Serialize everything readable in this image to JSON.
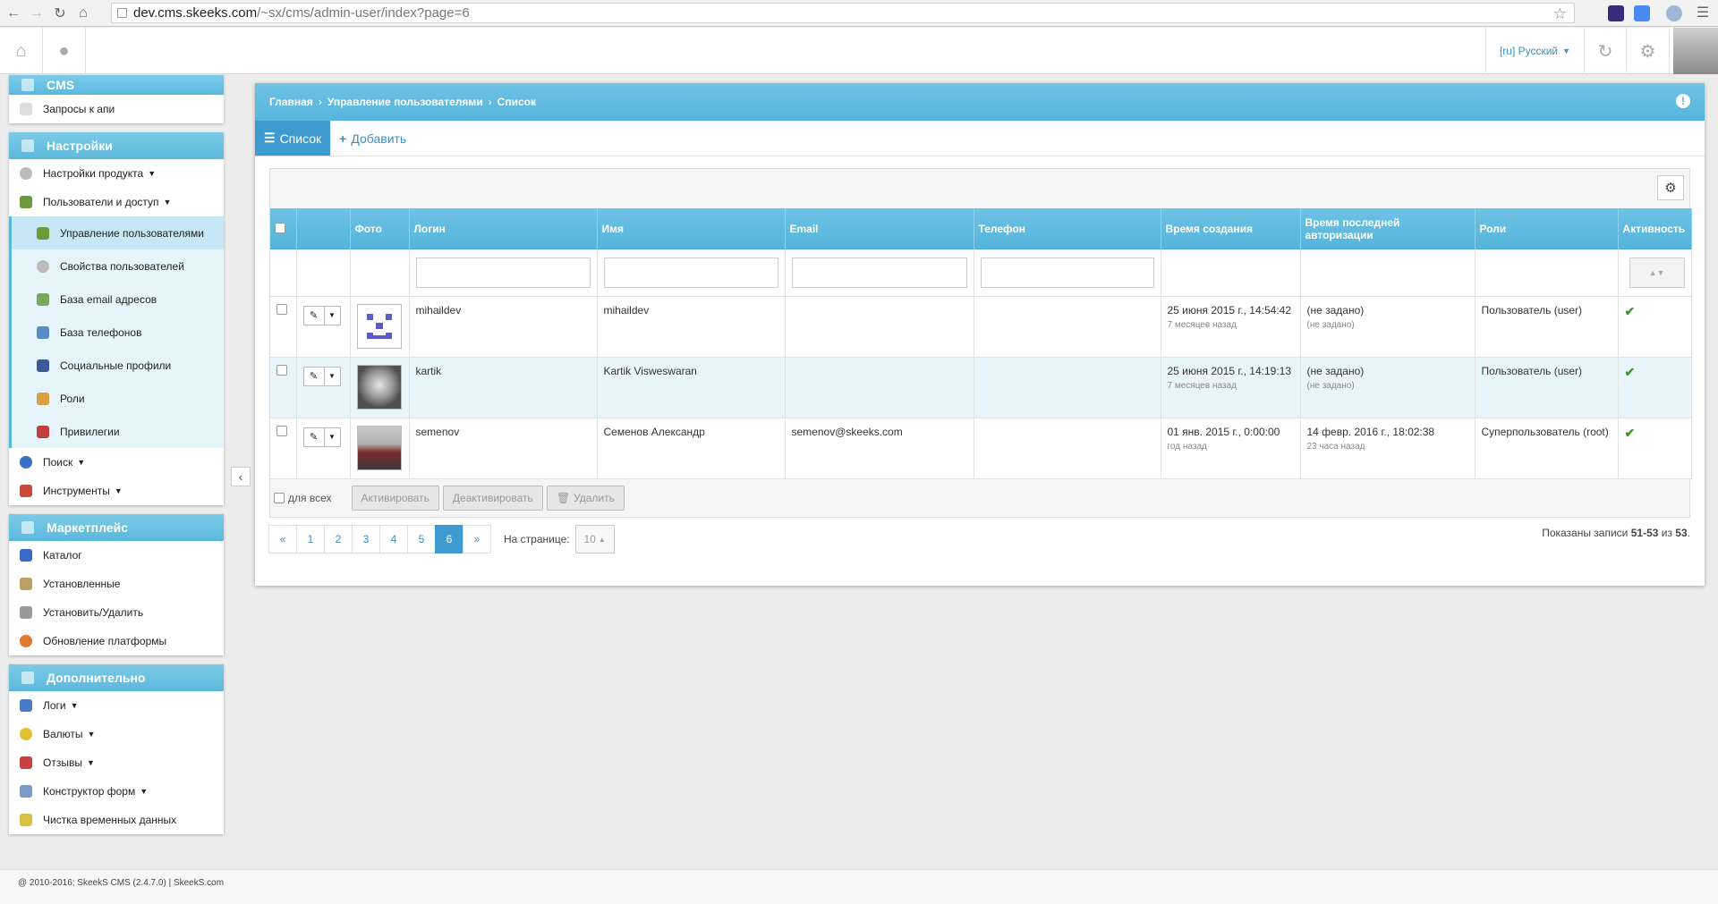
{
  "browser": {
    "url_host": "dev.cms.skeeks.com",
    "url_path": "/~sx/cms/admin-user/index?page=6"
  },
  "topbar": {
    "language": "[ru] Русский"
  },
  "sidebar": {
    "cms": {
      "title": "CMS",
      "items": [
        "Запросы к апи"
      ]
    },
    "settings": {
      "title": "Настройки",
      "items": [
        "Настройки продукта",
        "Пользователи и доступ"
      ],
      "subitems": [
        "Управление пользователями",
        "Свойства пользователей",
        "База email адресов",
        "База телефонов",
        "Социальные профили",
        "Роли",
        "Привилегии"
      ],
      "more": [
        "Поиск",
        "Инструменты"
      ]
    },
    "marketplace": {
      "title": "Маркетплейс",
      "items": [
        "Каталог",
        "Установленные",
        "Установить/Удалить",
        "Обновление платформы"
      ]
    },
    "extra": {
      "title": "Дополнительно",
      "items": [
        "Логи",
        "Валюты",
        "Отзывы",
        "Конструктор форм",
        "Чистка временных данных"
      ]
    }
  },
  "breadcrumb": [
    "Главная",
    "Управление пользователями",
    "Список"
  ],
  "tabs": {
    "list": "Список",
    "add": "Добавить"
  },
  "table": {
    "columns": [
      "Фото",
      "Логин",
      "Имя",
      "Email",
      "Телефон",
      "Время создания",
      "Время последней авторизации",
      "Роли",
      "Активность"
    ],
    "rows": [
      {
        "login": "mihaildev",
        "name": "mihaildev",
        "email": "",
        "phone": "",
        "created": "25 июня 2015 г., 14:54:42",
        "created_ago": "7 месяцев назад",
        "last_auth": "(не задано)",
        "last_auth_sub": "(не задано)",
        "roles": "Пользователь (user)"
      },
      {
        "login": "kartik",
        "name": "Kartik Visweswaran",
        "email": "",
        "phone": "",
        "created": "25 июня 2015 г., 14:19:13",
        "created_ago": "7 месяцев назад",
        "last_auth": "(не задано)",
        "last_auth_sub": "(не задано)",
        "roles": "Пользователь (user)"
      },
      {
        "login": "semenov",
        "name": "Семенов Александр",
        "email": "semenov@skeeks.com",
        "phone": "",
        "created": "01 янв. 2015 г., 0:00:00",
        "created_ago": "год назад",
        "last_auth": "14 февр. 2016 г., 18:02:38",
        "last_auth_sub": "23 часа назад",
        "roles": "Суперпользователь (root)"
      }
    ]
  },
  "bulk": {
    "all_label": "для всех",
    "activate": "Активировать",
    "deactivate": "Деактивировать",
    "delete": "Удалить"
  },
  "pager": {
    "prev": "«",
    "pages": [
      "1",
      "2",
      "3",
      "4",
      "5",
      "6"
    ],
    "next": "»",
    "active_page": 6,
    "per_page_label": "На странице:",
    "per_page_value": "10"
  },
  "summary": {
    "prefix": "Показаны записи ",
    "range": "51-53",
    "mid": " из ",
    "total": "53",
    "end": "."
  },
  "footer": "@ 2010-2016; SkeekS CMS (2.4.7.0) | SkeekS.com",
  "colors": {
    "accent": "#5bb8dc",
    "active_tab": "#3d9bd0",
    "check": "#3c9a2c"
  }
}
